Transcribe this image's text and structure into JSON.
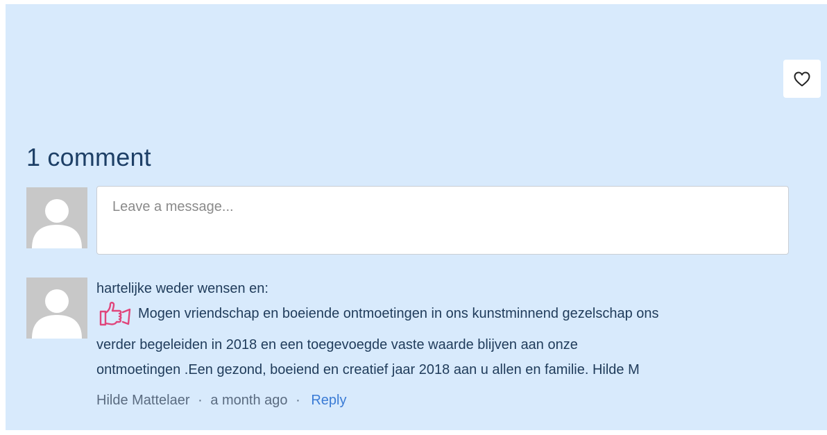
{
  "comments_section": {
    "count_label": "1 comment",
    "input": {
      "placeholder": "Leave a message..."
    }
  },
  "like": {
    "icon": "heart-outline-icon"
  },
  "comment": {
    "line1": "hartelijke weder wensen en:",
    "line2": "Mogen vriendschap en boeiende ontmoetingen in ons kunstminnend gezelschap ons",
    "line3": "verder begeleiden in 2018 en een toegevoegde vaste waarde blijven aan onze",
    "line4": "ontmoetingen .Een gezond, boeiend en creatief jaar 2018 aan u allen en familie. Hilde M",
    "emoji_icon": "thumbs-up-icon",
    "author": "Hilde Mattelaer",
    "separator": "·",
    "time": "a month ago",
    "reply_label": "Reply"
  },
  "colors": {
    "panel_bg": "#d8eafc",
    "heading": "#1d3f66",
    "link": "#3a7bd5",
    "emoji": "#e0457b"
  }
}
